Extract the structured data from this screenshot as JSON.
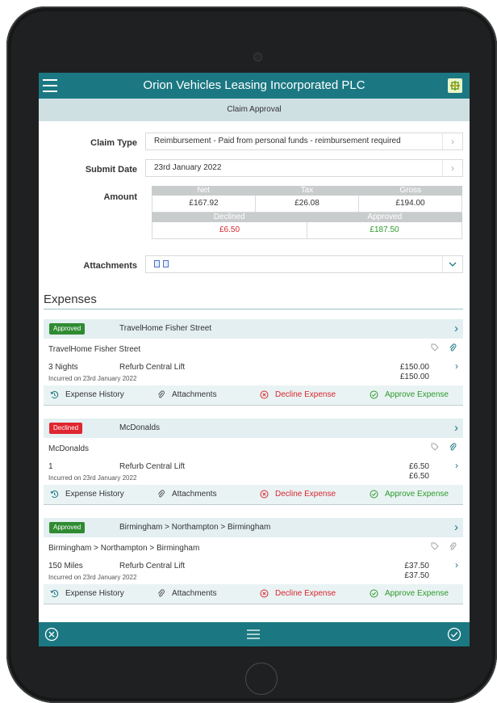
{
  "app": {
    "title": "Orion Vehicles Leasing Incorporated PLC",
    "subtitle": "Claim Approval",
    "accent": "#1b7882"
  },
  "form": {
    "claim_type_label": "Claim Type",
    "claim_type_value": "Reimbursement - Paid from personal funds - reimbursement required",
    "submit_date_label": "Submit Date",
    "submit_date_value": "23rd January 2022",
    "amount_label": "Amount",
    "attachments_label": "Attachments"
  },
  "amount": {
    "headers": [
      "Net",
      "Tax",
      "Gross"
    ],
    "values": [
      "£167.92",
      "£26.08",
      "£194.00"
    ],
    "status_headers": [
      "Declined",
      "Approved"
    ],
    "status_values": [
      "£6.50",
      "£187.50"
    ]
  },
  "expenses": {
    "title": "Expenses",
    "actions": {
      "history": "Expense History",
      "attachments": "Attachments",
      "decline": "Decline Expense",
      "approve": "Approve Expense"
    },
    "items": [
      {
        "status": "Approved",
        "vendor": "TravelHome Fisher Street",
        "name": "TravelHome Fisher Street",
        "quantity": "3 Nights",
        "project": "Refurb Central Lift",
        "incurred": "Incurred on 23rd January 2022",
        "amount1": "£150.00",
        "amount2": "£150.00"
      },
      {
        "status": "Declined",
        "vendor": "McDonalds",
        "name": "McDonalds",
        "quantity": "1",
        "project": "Refurb Central Lift",
        "incurred": "Incurred on 23rd January 2022",
        "amount1": "£6.50",
        "amount2": "£6.50"
      },
      {
        "status": "Approved",
        "vendor": "Birmingham > Northampton > Birmingham",
        "name": "Birmingham > Northampton > Birmingham",
        "quantity": "150 Miles",
        "project": "Refurb Central Lift",
        "incurred": "Incurred on 23rd January 2022",
        "amount1": "£37.50",
        "amount2": "£37.50"
      }
    ]
  },
  "icons": {
    "menu": "hamburger-icon",
    "logo": "company-logo-icon",
    "decline": "x-circle-icon",
    "approve": "check-circle-icon",
    "list": "list-icon"
  },
  "colors": {
    "approved": "#2f8b32",
    "declined": "#e0262f"
  }
}
